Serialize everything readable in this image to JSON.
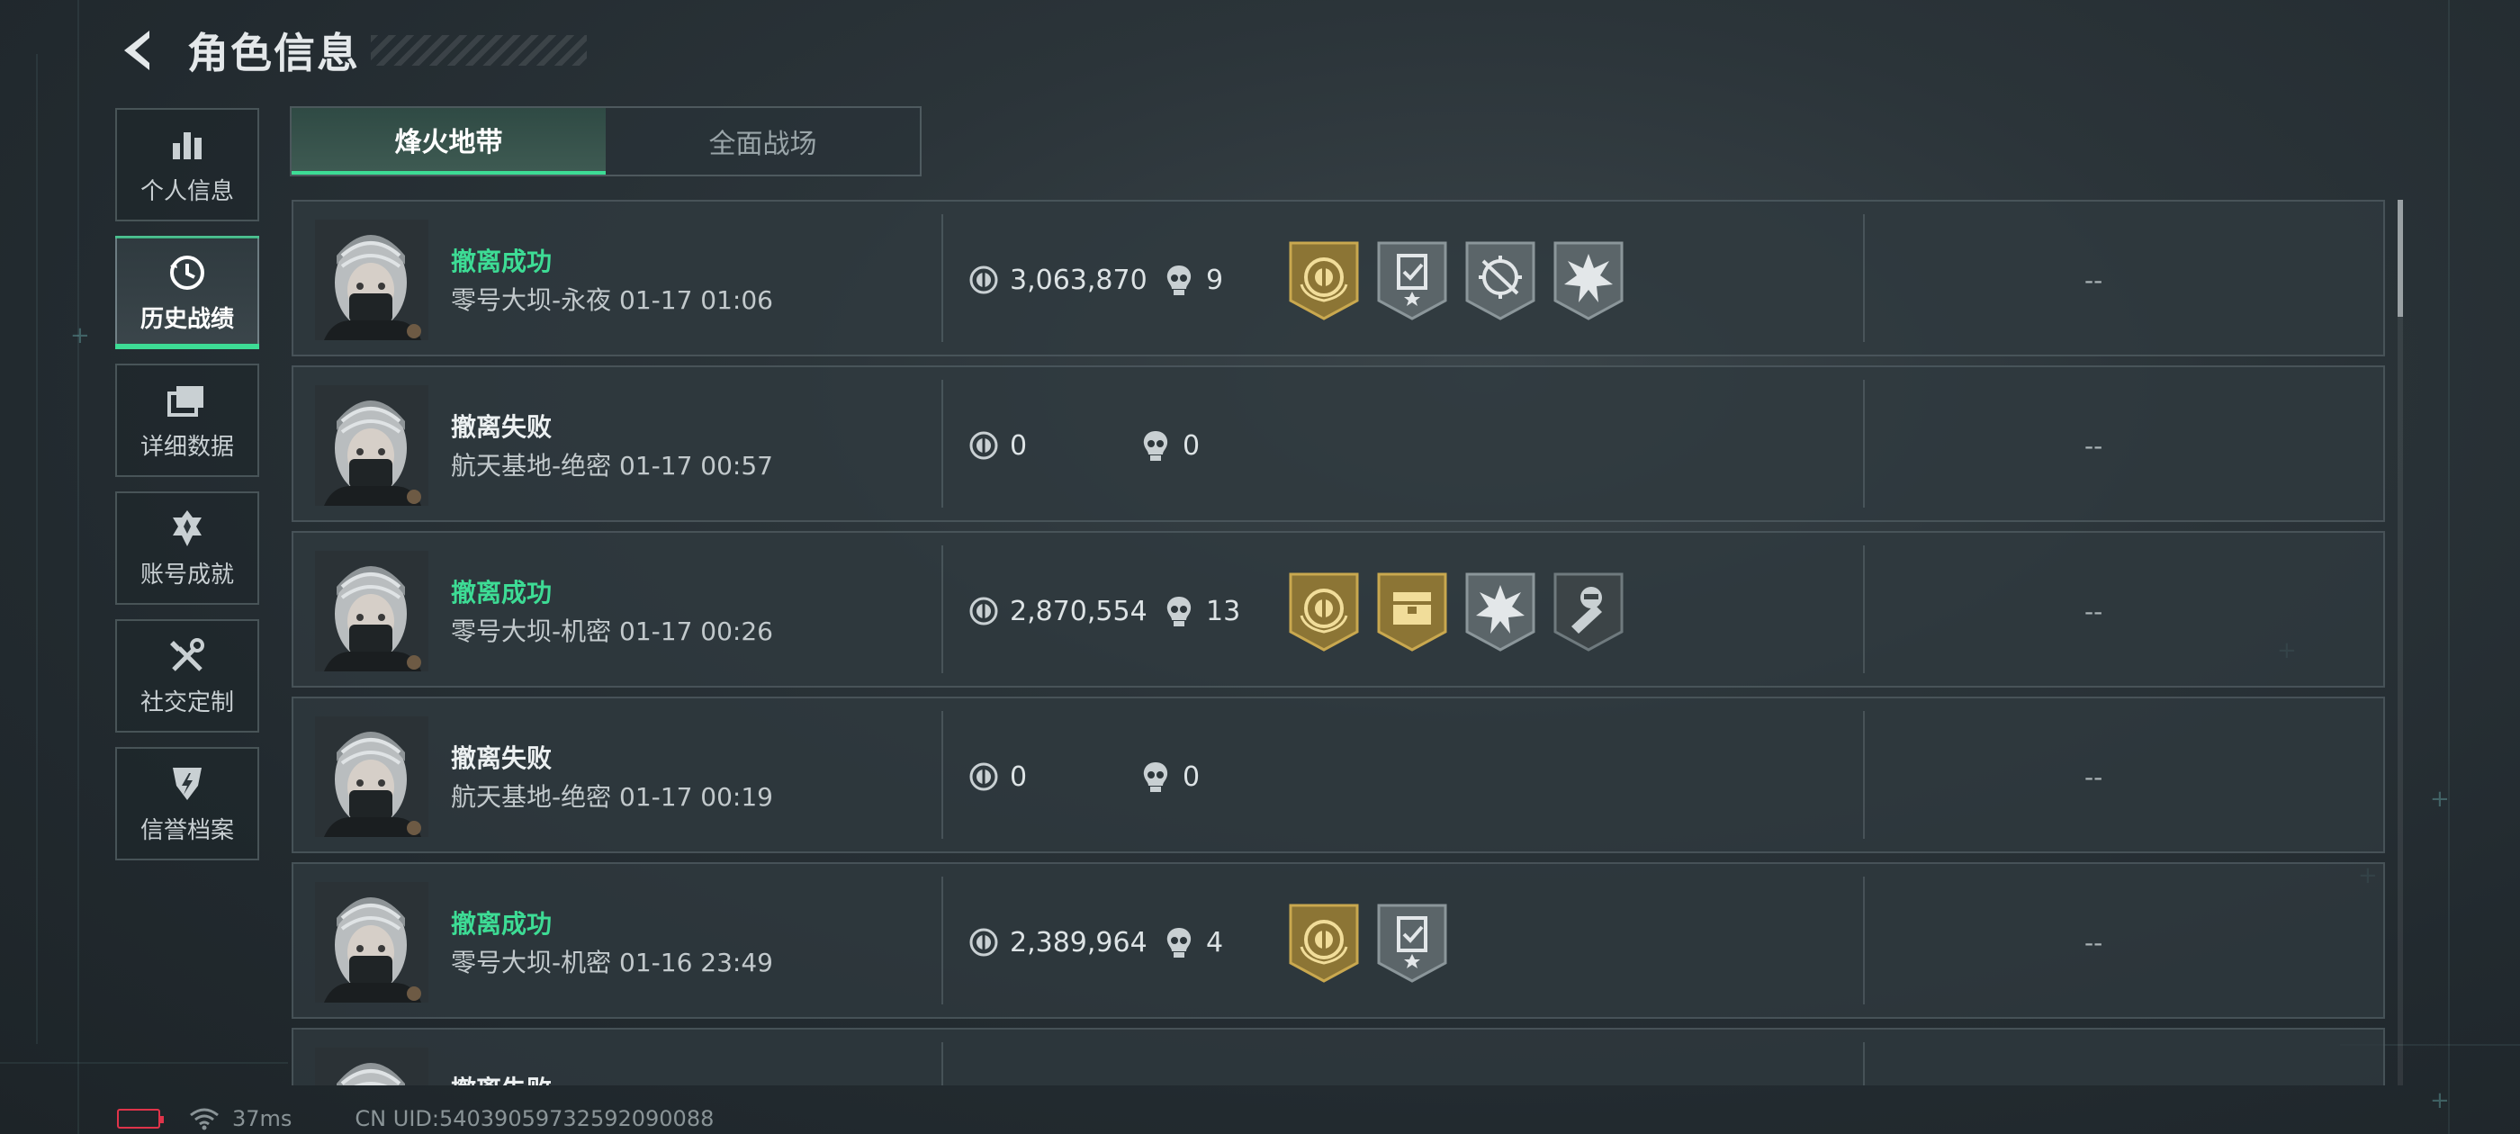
{
  "header": {
    "title": "角色信息"
  },
  "sidebar": {
    "items": [
      {
        "label": "个人信息",
        "icon": "bar-chart-icon",
        "active": false
      },
      {
        "label": "历史战绩",
        "icon": "clock-history-icon",
        "active": true
      },
      {
        "label": "详细数据",
        "icon": "stacked-cards-icon",
        "active": false
      },
      {
        "label": "账号成就",
        "icon": "achievement-badge-icon",
        "active": false
      },
      {
        "label": "社交定制",
        "icon": "tools-icon",
        "active": false
      },
      {
        "label": "信誉档案",
        "icon": "credit-shield-icon",
        "active": false
      }
    ]
  },
  "tabs": [
    {
      "label": "烽火地带",
      "active": true
    },
    {
      "label": "全面战场",
      "active": false
    }
  ],
  "records": [
    {
      "status": "撤离成功",
      "success": true,
      "map": "零号大坝-永夜",
      "time": "01-17 01:06",
      "money": "3,063,870",
      "kills": "9",
      "badges": [
        "gold-coin-badge",
        "gray-clipboard-star-badge",
        "gray-crosshair-badge",
        "gray-burst-badge"
      ],
      "extra": "--"
    },
    {
      "status": "撤离失败",
      "success": false,
      "map": "航天基地-绝密",
      "time": "01-17 00:57",
      "money": "0",
      "kills": "0",
      "badges": [],
      "extra": "--"
    },
    {
      "status": "撤离成功",
      "success": true,
      "map": "零号大坝-机密",
      "time": "01-17 00:26",
      "money": "2,870,554",
      "kills": "13",
      "badges": [
        "gold-coin-badge",
        "gold-crate-badge",
        "gray-burst-badge",
        "dark-soldier-badge"
      ],
      "extra": "--"
    },
    {
      "status": "撤离失败",
      "success": false,
      "map": "航天基地-绝密",
      "time": "01-17 00:19",
      "money": "0",
      "kills": "0",
      "badges": [],
      "extra": "--"
    },
    {
      "status": "撤离成功",
      "success": true,
      "map": "零号大坝-机密",
      "time": "01-16 23:49",
      "money": "2,389,964",
      "kills": "4",
      "badges": [
        "gold-coin-badge",
        "gray-clipboard-star-badge"
      ],
      "extra": "--"
    },
    {
      "status": "撤离失败",
      "success": false,
      "map": "",
      "time": "",
      "money": "",
      "kills": "",
      "badges": [],
      "extra": ""
    }
  ],
  "footer": {
    "ping": "37ms",
    "uid": "CN UID:54039059732592090088"
  },
  "colors": {
    "accent": "#3ddc95",
    "battery_low": "#e0344a",
    "gold": "#b89a4a",
    "panel": "#303a3f"
  }
}
